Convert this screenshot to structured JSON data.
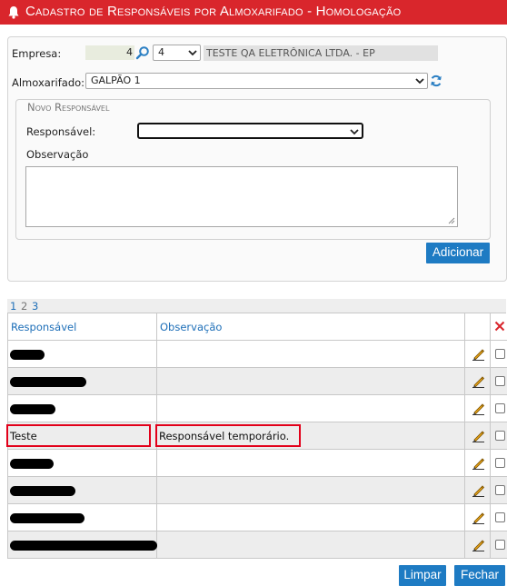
{
  "header": {
    "title": "Cadastro de Responsáveis por Almoxarifado  - Homologação"
  },
  "form": {
    "empresa_label": "Empresa:",
    "empresa_code": "4",
    "empresa_select": "4",
    "empresa_name": "TESTE QA ELETRÔNICA LTDA. - EP",
    "almox_label": "Almoxarifado:",
    "almox_value": "GALPÃO 1"
  },
  "novo": {
    "legend": "Novo Responsável",
    "responsavel_label": "Responsável:",
    "responsavel_value": "",
    "observacao_label": "Observação",
    "observacao_value": "",
    "add_label": "Adicionar"
  },
  "grid": {
    "pages": [
      "1",
      "2",
      "3"
    ],
    "current_page": "2",
    "columns": [
      "Responsável",
      "Observação"
    ],
    "rows": [
      {
        "responsavel": "",
        "observacao": ""
      },
      {
        "responsavel": "",
        "observacao": ""
      },
      {
        "responsavel": "",
        "observacao": ""
      },
      {
        "responsavel": "Teste",
        "observacao": "Responsável temporário."
      },
      {
        "responsavel": "",
        "observacao": ""
      },
      {
        "responsavel": "",
        "observacao": ""
      },
      {
        "responsavel": "",
        "observacao": ""
      },
      {
        "responsavel": "",
        "observacao": ""
      }
    ]
  },
  "footer": {
    "clear_label": "Limpar",
    "close_label": "Fechar"
  },
  "colors": {
    "header_bg": "#d9262c",
    "button": "#1e7bc3",
    "link": "#1e6fb8",
    "highlight": "#e2001a"
  },
  "icons": [
    "bell-icon",
    "search-icon",
    "refresh-icon",
    "pencil-icon",
    "delete-x-icon"
  ]
}
